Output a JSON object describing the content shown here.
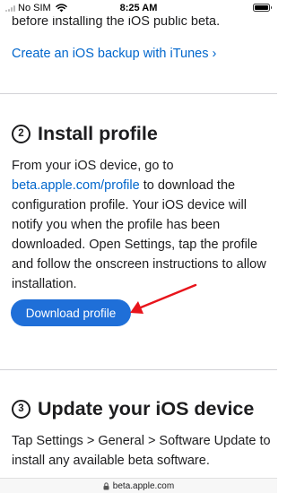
{
  "status_bar": {
    "carrier": "No SIM",
    "time": "8:25 AM",
    "signal_icon": "signal-dots-icon",
    "wifi_icon": "wifi-icon",
    "battery_icon": "battery-icon",
    "battery_level": 1.0
  },
  "intro": {
    "text": "before installing the iOS public beta.",
    "backup_link": "Create an iOS backup with iTunes ›"
  },
  "step2": {
    "number": "2",
    "title": "Install profile",
    "text_before_link": "From your iOS device, go to ",
    "link_text": "beta.apple.com/profile",
    "text_after_link": " to download the configuration profile. Your iOS device will notify you when the profile has been downloaded. Open Settings, tap the profile and follow the onscreen instructions to allow installation.",
    "button_label": "Download profile"
  },
  "step3": {
    "number": "3",
    "title": "Update your iOS device",
    "text": "Tap Settings > General > Software Update to install any available beta software."
  },
  "url_bar": {
    "lock_icon": "lock-icon",
    "url": "beta.apple.com"
  },
  "colors": {
    "link": "#0066cc",
    "button": "#1f6fd8",
    "annotation_arrow": "#e8141b",
    "text": "#1d1d1f"
  }
}
